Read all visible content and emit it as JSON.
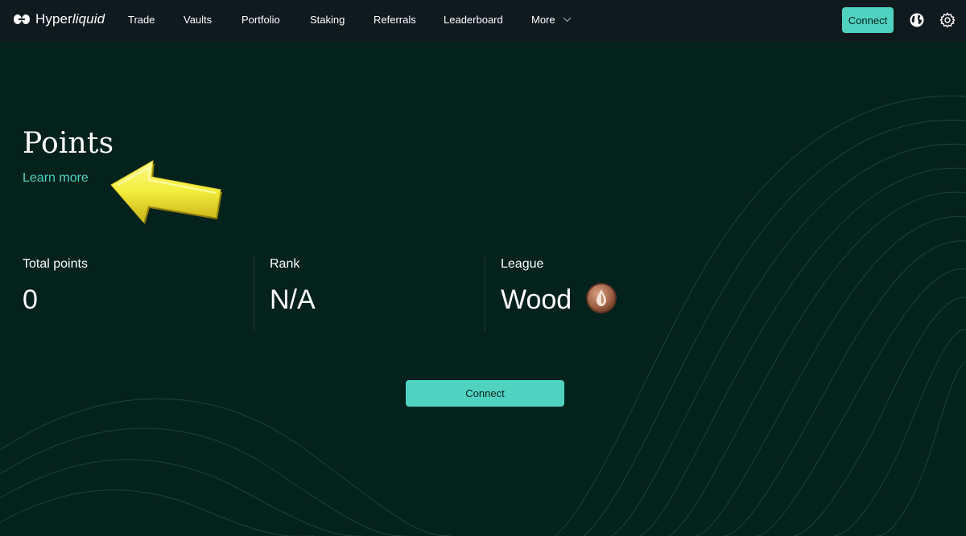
{
  "brand": {
    "name_prefix": "Hyper",
    "name_suffix": "liquid",
    "accent_color": "#50d2c1"
  },
  "nav": {
    "items": [
      {
        "label": "Trade"
      },
      {
        "label": "Vaults"
      },
      {
        "label": "Portfolio"
      },
      {
        "label": "Staking"
      },
      {
        "label": "Referrals"
      },
      {
        "label": "Leaderboard"
      },
      {
        "label": "More"
      }
    ],
    "connect_label": "Connect",
    "icons": [
      "globe-icon",
      "gear-icon"
    ]
  },
  "page": {
    "title": "Points",
    "learn_more": "Learn more",
    "annotation_icon": "arrow-pointer-icon"
  },
  "stats": [
    {
      "label": "Total points",
      "value": "0"
    },
    {
      "label": "Rank",
      "value": "N/A"
    },
    {
      "label": "League",
      "value": "Wood",
      "badge_icon": "wood-league-badge-icon"
    }
  ],
  "connect_button": {
    "label": "Connect"
  },
  "colors": {
    "background": "#04221c",
    "topbar": "#0f1a1f",
    "accent": "#50d2c1",
    "arrow": "#f2ee3c"
  }
}
